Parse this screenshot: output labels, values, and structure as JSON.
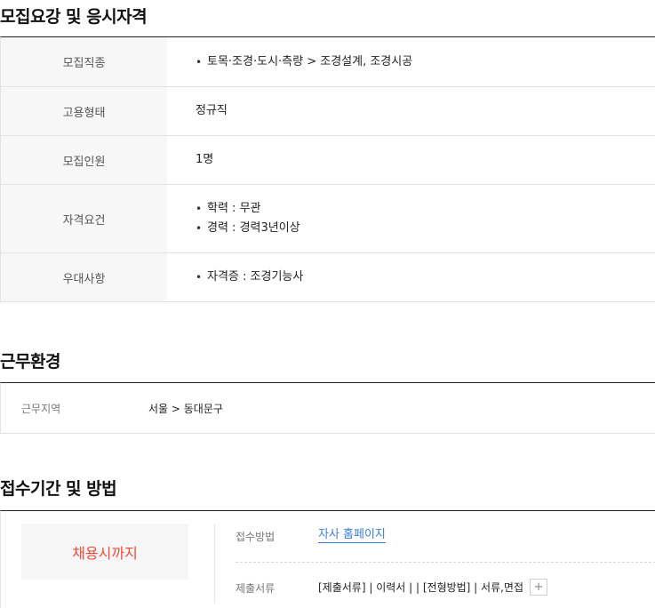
{
  "sections": {
    "requirements": {
      "title": "모집요강 및 응시자격",
      "rows": [
        {
          "label": "모집직종",
          "values": [
            "토목·조경·도시·측량 > 조경설계, 조경시공"
          ],
          "bullet": true
        },
        {
          "label": "고용형태",
          "values": [
            "정규직"
          ],
          "bullet": false
        },
        {
          "label": "모집인원",
          "values": [
            "1명"
          ],
          "bullet": false
        },
        {
          "label": "자격요건",
          "values": [
            "학력 : 무관",
            "경력 : 경력3년이상"
          ],
          "bullet": true
        },
        {
          "label": "우대사항",
          "values": [
            "자격증 : 조경기능사"
          ],
          "bullet": true
        }
      ]
    },
    "environment": {
      "title": "근무환경",
      "label": "근무지역",
      "value": "서울 > 동대문구"
    },
    "apply": {
      "title": "접수기간 및 방법",
      "deadline": "채용시까지",
      "method_label": "접수방법",
      "method_value": "자사 홈페이지",
      "docs_label": "제출서류",
      "docs_value": "[제출서류] | 이력서 | | [전형방법] | 서류,면접",
      "docs_more": "+"
    }
  },
  "colors": {
    "accent_red": "#ef4a3a",
    "link_blue": "#3a7fe0"
  }
}
